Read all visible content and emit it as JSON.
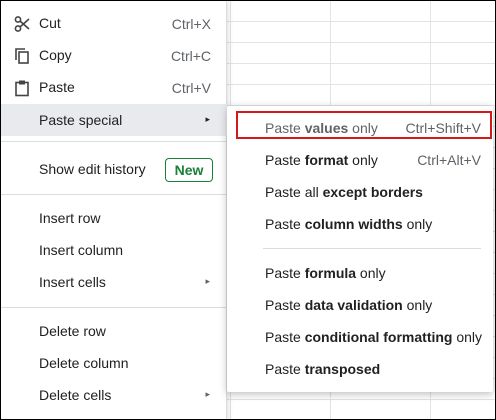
{
  "menu": {
    "items": [
      {
        "label": "Cut",
        "shortcut": "Ctrl+X",
        "icon": "scissors-icon"
      },
      {
        "label": "Copy",
        "shortcut": "Ctrl+C",
        "icon": "copy-icon"
      },
      {
        "label": "Paste",
        "shortcut": "Ctrl+V",
        "icon": "clipboard-icon"
      },
      {
        "label": "Paste special",
        "arrow": "▸"
      },
      {
        "label": "Show edit history",
        "badge": "New"
      },
      {
        "label": "Insert row"
      },
      {
        "label": "Insert column"
      },
      {
        "label": "Insert cells",
        "arrow": "▸"
      },
      {
        "label": "Delete row"
      },
      {
        "label": "Delete column"
      },
      {
        "label": "Delete cells",
        "arrow": "▸"
      }
    ]
  },
  "submenu": {
    "items": [
      {
        "pre": "Paste ",
        "bold": "values",
        "post": " only",
        "shortcut": "Ctrl+Shift+V"
      },
      {
        "pre": "Paste ",
        "bold": "format",
        "post": " only",
        "shortcut": "Ctrl+Alt+V"
      },
      {
        "pre": "Paste all ",
        "bold": "except borders",
        "post": ""
      },
      {
        "pre": "Paste ",
        "bold": "column widths",
        "post": " only"
      },
      {
        "pre": "Paste ",
        "bold": "formula",
        "post": " only"
      },
      {
        "pre": "Paste ",
        "bold": "data validation",
        "post": " only"
      },
      {
        "pre": "Paste ",
        "bold": "conditional formatting",
        "post": " only"
      },
      {
        "pre": "Paste ",
        "bold": "transposed",
        "post": ""
      }
    ]
  },
  "colors": {
    "highlight_border": "#d21a1a",
    "badge_green": "#188038",
    "hover_bg": "#e8eaed"
  }
}
